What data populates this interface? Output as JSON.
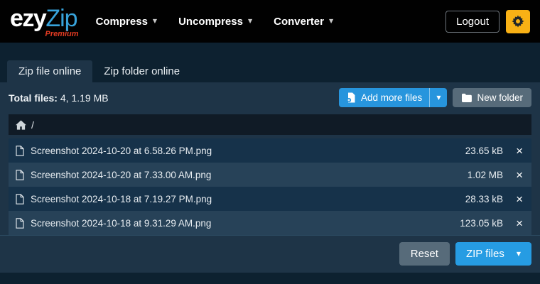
{
  "navbar": {
    "logo_part1": "ezy",
    "logo_part2": "Zip",
    "logo_badge": "Premium",
    "menus": [
      {
        "label": "Compress"
      },
      {
        "label": "Uncompress"
      },
      {
        "label": "Converter"
      }
    ],
    "logout_label": "Logout"
  },
  "tabs": [
    {
      "label": "Zip file online",
      "active": true
    },
    {
      "label": "Zip folder online",
      "active": false
    }
  ],
  "toolbar": {
    "total_label": "Total files:",
    "total_value": "4, 1.19 MB",
    "add_more_files_label": "Add more files",
    "new_folder_label": "New folder"
  },
  "breadcrumb": {
    "path": "/"
  },
  "files": [
    {
      "name": "Screenshot 2024-10-20 at 6.58.26 PM.png",
      "size": "23.65 kB"
    },
    {
      "name": "Screenshot 2024-10-20 at 7.33.00 AM.png",
      "size": "1.02 MB"
    },
    {
      "name": "Screenshot 2024-10-18 at 7.19.27 PM.png",
      "size": "28.33 kB"
    },
    {
      "name": "Screenshot 2024-10-18 at 9.31.29 AM.png",
      "size": "123.05 kB"
    }
  ],
  "footer": {
    "reset_label": "Reset",
    "zip_label": "ZIP files"
  },
  "icons": {
    "caret": "▼",
    "close": "×"
  },
  "colors": {
    "navbar_bg": "#010101",
    "page_bg": "#0d2130",
    "panel_bg": "#1e3447",
    "row_dark": "#16324a",
    "row_light": "#274258",
    "accent_blue": "#2795dd",
    "zip_blue": "#269ce3",
    "warning_yellow": "#f9b115",
    "gray_button": "#576b7a",
    "logo_blue": "#38a3db",
    "premium_red": "#e23b22"
  }
}
